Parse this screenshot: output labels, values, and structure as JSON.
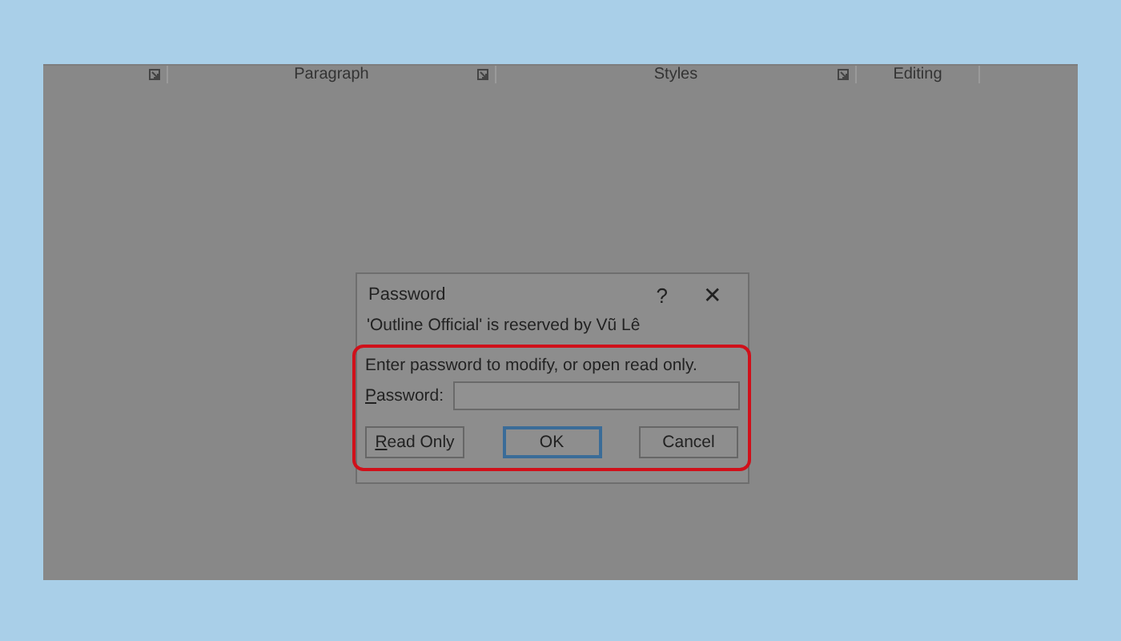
{
  "ribbon": {
    "groups": [
      {
        "launcher": true
      },
      {
        "label": "Paragraph",
        "launcher": true
      },
      {
        "label": "Styles",
        "launcher": true
      },
      {
        "label": "Editing",
        "launcher": false
      }
    ]
  },
  "dialog": {
    "title": "Password",
    "help": "?",
    "close": "✕",
    "reserved": "'Outline Official' is reserved by Vũ Lê",
    "prompt": "Enter password to modify, or open read only.",
    "field_label": "Password:",
    "buttons": [
      {
        "label": "Read Only",
        "default": false
      },
      {
        "label": "OK",
        "default": true
      },
      {
        "label": "Cancel",
        "default": false
      }
    ]
  }
}
